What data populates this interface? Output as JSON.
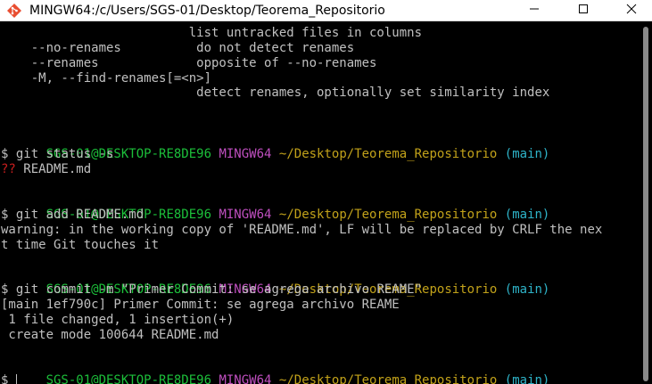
{
  "window": {
    "title": "MINGW64:/c/Users/SGS-01/Desktop/Teorema_Repositorio",
    "icon": "git-bash-icon",
    "controls": [
      "minimize-icon",
      "maximize-icon",
      "close-icon"
    ]
  },
  "colors": {
    "background": "#000000",
    "text": "#c0c0c0",
    "prompt_user": "#1cbf3a",
    "prompt_mingw": "#bf4fbf",
    "prompt_path": "#c2a21a",
    "prompt_branch": "#2eb3c8",
    "untracked": "#c81e1e"
  },
  "terminal": {
    "help": [
      "                         list untracked files in columns",
      "    --no-renames          do not detect renames",
      "    --renames             opposite of --no-renames",
      "    -M, --find-renames[=<n>]",
      "                          detect renames, optionally set similarity index"
    ],
    "prompt": {
      "user_host": "SGS-01@DESKTOP-RE8DE96",
      "system": "MINGW64",
      "path": "~/Desktop/Teorema_Repositorio",
      "branch": "(main)",
      "symbol": "$"
    },
    "blocks": [
      {
        "command": "git status -s",
        "output": [
          {
            "marker": "??",
            "text": " README.md"
          }
        ]
      },
      {
        "command": "git add README.md",
        "output": [
          {
            "text": "warning: in the working copy of 'README.md', LF will be replaced by CRLF the nex"
          },
          {
            "text": "t time Git touches it"
          }
        ]
      },
      {
        "command": "git commit -m \"Primer Commit: se agrega archivo REAME\"",
        "output": [
          {
            "text": "[main 1ef790c] Primer Commit: se agrega archivo REAME"
          },
          {
            "text": " 1 file changed, 1 insertion(+)"
          },
          {
            "text": " create mode 100644 README.md"
          }
        ]
      }
    ],
    "current_input": ""
  }
}
